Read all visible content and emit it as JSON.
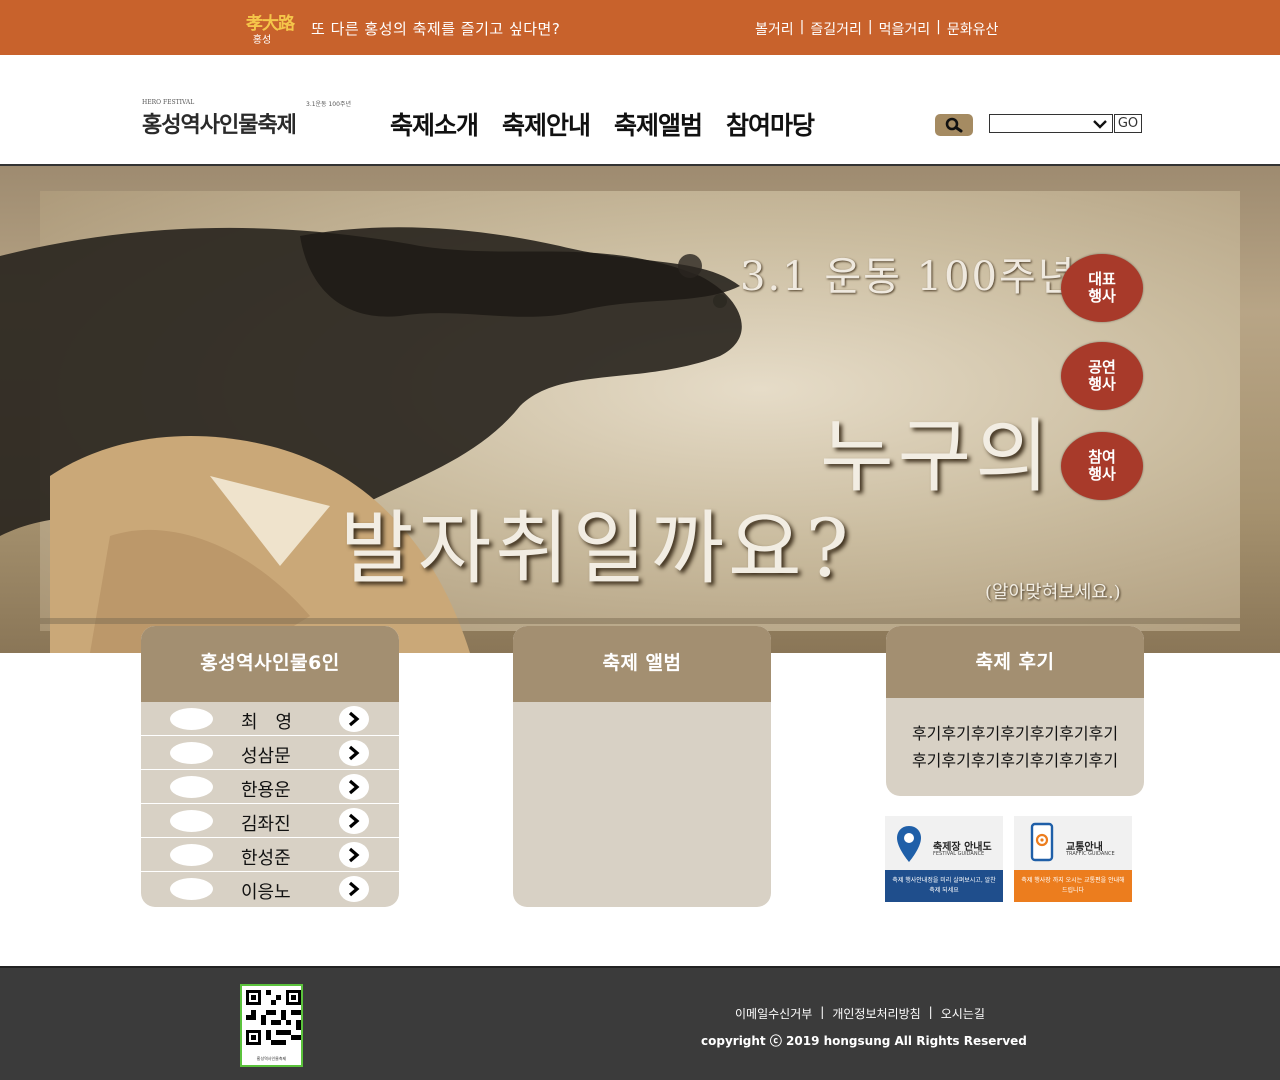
{
  "topbar": {
    "logo_glyphs": "孝大路",
    "logo_city": "홍성",
    "tagline": "또 다른 홍성의 축제를 즐기고 싶다면?",
    "links": [
      "볼거리",
      "즐길거리",
      "먹을거리",
      "문화유산"
    ]
  },
  "header": {
    "brand_small_en": "HERO FESTIVAL",
    "brand_small_kr": "3.1운동 100주년",
    "brand_name": "홍성역사인물축제",
    "nav": [
      "축제소개",
      "축제안내",
      "축제앨범",
      "참여마당"
    ],
    "search_icon": "search-icon",
    "select_value": "",
    "go_label": "GO"
  },
  "hero": {
    "anniversary": "3.1 운동 100주년",
    "question_line1": "누구의",
    "question_line2": "발자취일까요?",
    "question_hint": "(알아맞혀보세요.)",
    "bubbles": [
      "대표 행사",
      "공연 행사",
      "참여 행사"
    ]
  },
  "panels": {
    "people": {
      "title": "홍성역사인물6인",
      "items": [
        "최　영",
        "성삼문",
        "한용운",
        "김좌진",
        "한성준",
        "이응노"
      ]
    },
    "album": {
      "title": "축제 앨범"
    },
    "review": {
      "title": "축제 후기",
      "lines": [
        "후기후기후기후기후기후기후기",
        "후기후기후기후기후기후기후기"
      ]
    }
  },
  "banners": [
    {
      "title": "축제장 안내도",
      "sub": "FESTIVAL GUIDANCE",
      "desc": "축제 행사안내정을 미리 살펴보시고, 알찬 축제 되세요",
      "icon": "map-pin-icon",
      "color": "#1f4e8c"
    },
    {
      "title": "교통안내",
      "sub": "TRAFFIC GUIDANCE",
      "desc": "축제 행사장 까지 오시는 교통편을 안내해 드립니다",
      "icon": "phone-location-icon",
      "color": "#ec7d1e"
    }
  ],
  "footer": {
    "qr_caption": "홍성역사인물축제",
    "links": [
      "이메일수신거부",
      "개인정보처리방침",
      "오시는길"
    ],
    "copyright": "copyright ⓒ 2019 hongsung All Rights Reserved"
  },
  "colors": {
    "topbar": "#c8622c",
    "panel_header": "#a38f71",
    "panel_body": "#d8d1c5",
    "bubble": "#a83a2a",
    "footer": "#3b3b3b"
  }
}
